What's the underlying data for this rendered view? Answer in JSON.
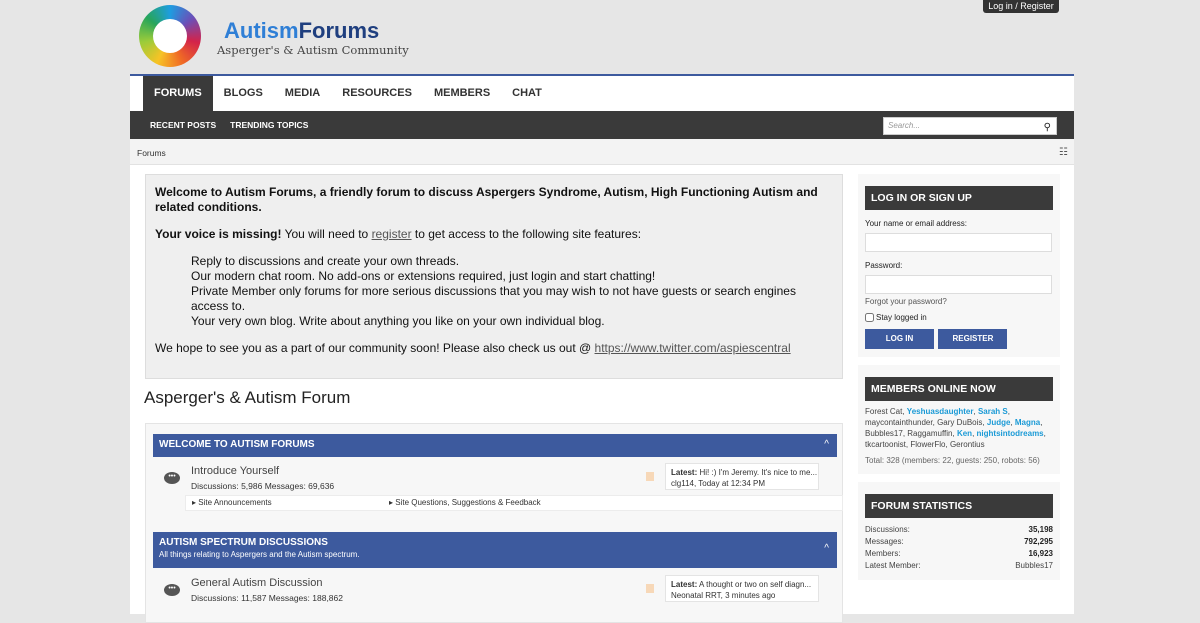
{
  "top": {
    "login_register": "Log in / Register"
  },
  "brand": {
    "name_a": "Autism",
    "name_b": "Forums",
    "tagline": "Asperger's & Autism Community"
  },
  "nav": [
    "FORUMS",
    "BLOGS",
    "MEDIA",
    "RESOURCES",
    "MEMBERS",
    "CHAT"
  ],
  "subnav": [
    "RECENT POSTS",
    "TRENDING TOPICS"
  ],
  "search": {
    "placeholder": "Search..."
  },
  "breadcrumb": "Forums",
  "notice": {
    "welcome": "Welcome to Autism Forums, a friendly forum to discuss Aspergers Syndrome, Autism, High Functioning Autism and related conditions.",
    "missing_bold": "Your voice is missing!",
    "missing_a": " You will need to ",
    "register": "register",
    "missing_b": " to get access to the following site features:",
    "features": [
      "Reply to discussions and create your own threads.",
      "Our modern chat room. No add-ons or extensions required, just login and start chatting!",
      "Private Member only forums for more serious discussions that you may wish to not have guests or search engines access to.",
      "Your very own blog. Write about anything you like on your own individual blog."
    ],
    "closing": "We hope to see you as a part of our community soon! Please also check us out @ ",
    "twitter": "https://www.twitter.com/aspiescentral"
  },
  "forum_title": "Asperger's & Autism Forum",
  "categories": [
    {
      "title": "WELCOME TO AUTISM FORUMS",
      "desc": "",
      "node": {
        "name": "Introduce Yourself",
        "stats": "Discussions: 5,986   Messages: 69,636",
        "latest": "Hi! :) I'm Jeremy. It's nice to me...",
        "latest_by": "clg114, Today at 12:34 PM"
      },
      "subforums": [
        "Site Announcements",
        "Site Questions, Suggestions & Feedback"
      ]
    },
    {
      "title": "AUTISM SPECTRUM DISCUSSIONS",
      "desc": "All things relating to Aspergers and the Autism spectrum.",
      "node": {
        "name": "General Autism Discussion",
        "stats": "Discussions: 11,587   Messages: 188,862",
        "latest": "A thought or two on self diagn...",
        "latest_by": "Neonatal RRT, 3 minutes ago"
      }
    }
  ],
  "latest_label": "Latest:",
  "login": {
    "title": "LOG IN OR SIGN UP",
    "name_label": "Your name or email address:",
    "password_label": "Password:",
    "forgot": "Forgot your password?",
    "stay": "Stay logged in",
    "login_btn": "LOG IN",
    "register_btn": "REGISTER"
  },
  "online": {
    "title": "MEMBERS ONLINE NOW",
    "members": [
      {
        "n": "Forest Cat",
        "h": false
      },
      {
        "n": "Yeshuasdaughter",
        "h": true
      },
      {
        "n": "Sarah S",
        "h": true
      },
      {
        "n": "maycontainthunder",
        "h": false
      },
      {
        "n": "Gary DuBois",
        "h": false
      },
      {
        "n": "Judge",
        "h": true
      },
      {
        "n": "Magna",
        "h": true
      },
      {
        "n": "Bubbles17",
        "h": false
      },
      {
        "n": "Raggamuffin",
        "h": false
      },
      {
        "n": "Ken",
        "h": true
      },
      {
        "n": "nightsintodreams",
        "h": true
      },
      {
        "n": "tkcartoonist",
        "h": false
      },
      {
        "n": "FlowerFlo",
        "h": false
      },
      {
        "n": "Gerontius",
        "h": false
      }
    ],
    "total": "Total: 328 (members: 22, guests: 250, robots: 56)"
  },
  "stats": {
    "title": "FORUM STATISTICS",
    "rows": [
      {
        "k": "Discussions:",
        "v": "35,198"
      },
      {
        "k": "Messages:",
        "v": "792,295"
      },
      {
        "k": "Members:",
        "v": "16,923"
      },
      {
        "k": "Latest Member:",
        "v": "Bubbles17"
      }
    ]
  },
  "colors": {
    "accent": "#3d5a9e",
    "dark": "#3a3a3a",
    "highlight": "#1a9ad6"
  }
}
